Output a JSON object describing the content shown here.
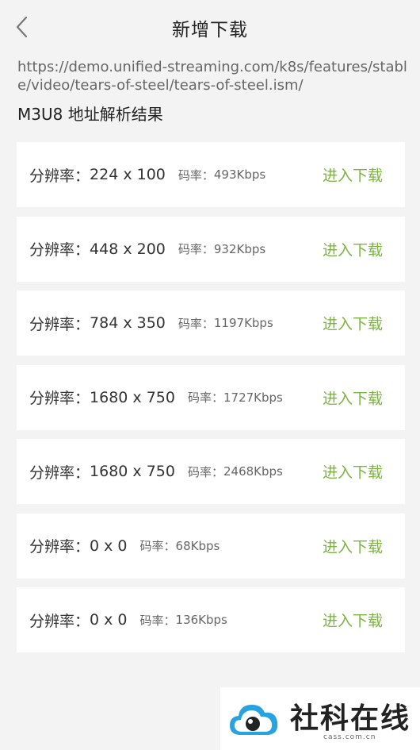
{
  "header": {
    "title": "新增下载",
    "back_icon": "chevron-left-icon"
  },
  "source_url": "https://demo.unified-streaming.com/k8s/features/stable/video/tears-of-steel/tears-of-steel.ism/",
  "result_title": "M3U8 地址解析结果",
  "labels": {
    "resolution": "分辨率：",
    "bitrate": "码率：",
    "download": "进入下载"
  },
  "variants": [
    {
      "resolution": "224 x 100",
      "bitrate": "493Kbps"
    },
    {
      "resolution": "448 x 200",
      "bitrate": "932Kbps"
    },
    {
      "resolution": "784 x 350",
      "bitrate": "1197Kbps"
    },
    {
      "resolution": "1680 x 750",
      "bitrate": "1727Kbps"
    },
    {
      "resolution": "1680 x 750",
      "bitrate": "2468Kbps"
    },
    {
      "resolution": "0 x 0",
      "bitrate": "68Kbps"
    },
    {
      "resolution": "0 x 0",
      "bitrate": "136Kbps"
    }
  ],
  "watermark": {
    "text": "社科在线",
    "domain": "cass.com.cn"
  },
  "colors": {
    "accent": "#7cb342",
    "background": "#f3f3f3"
  }
}
